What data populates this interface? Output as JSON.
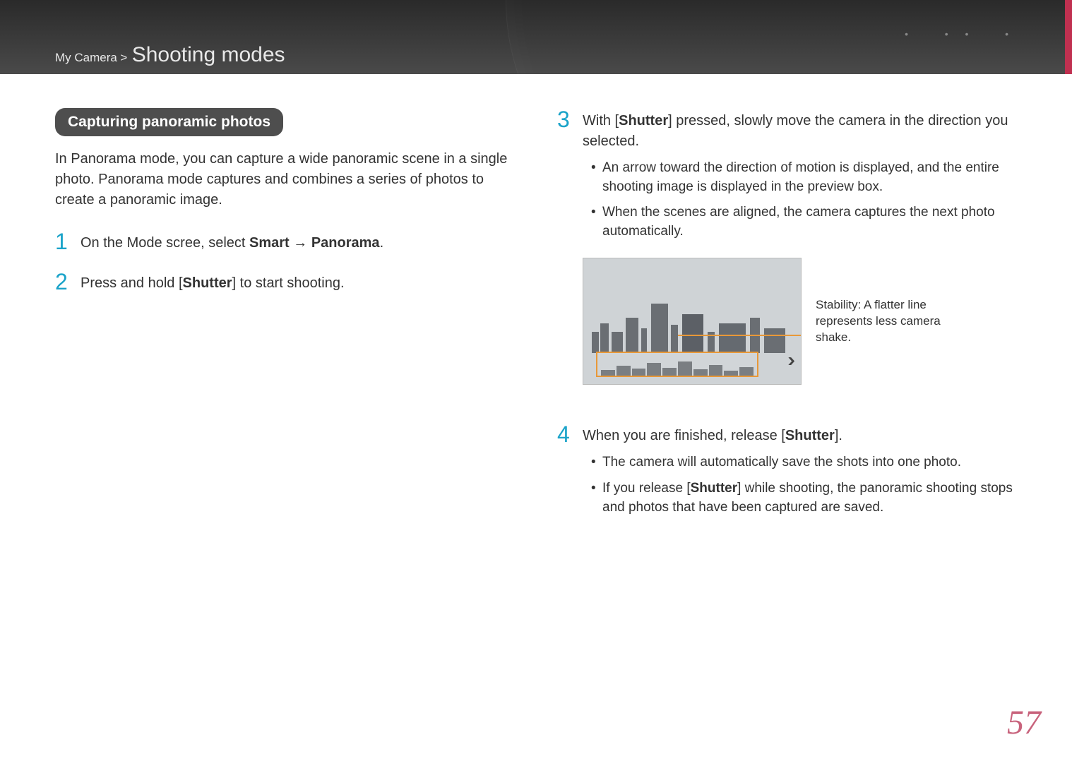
{
  "breadcrumb": {
    "parent": "My Camera",
    "separator": ">",
    "current": "Shooting modes"
  },
  "pill": "Capturing panoramic photos",
  "intro": "In Panorama mode, you can capture a wide panoramic scene in a single photo. Panorama mode captures and combines a series of photos to create a panoramic image.",
  "steps_left": {
    "s1": {
      "num": "1",
      "pre": "On the Mode scree, select ",
      "b1": "Smart",
      "arrow": " → ",
      "b2": "Panorama",
      "post": "."
    },
    "s2": {
      "num": "2",
      "pre": "Press and hold [",
      "b1": "Shutter",
      "post": "] to start shooting."
    }
  },
  "steps_right": {
    "s3": {
      "num": "3",
      "pre": "With [",
      "b1": "Shutter",
      "post": "] pressed, slowly move the camera in the direction you selected.",
      "bullets": [
        "An arrow toward the direction of motion is displayed, and the entire shooting image is displayed in the preview box.",
        "When the scenes are aligned, the camera captures the next photo automatically."
      ]
    },
    "caption": "Stability: A flatter line represents less camera shake.",
    "s4": {
      "num": "4",
      "pre": "When you are finished, release [",
      "b1": "Shutter",
      "post": "].",
      "bullets_html": {
        "b1": "The camera will automatically save the shots into one photo.",
        "b2_pre": "If you release [",
        "b2_bold": "Shutter",
        "b2_post": "] while shooting, the panoramic shooting stops and photos that have been captured are saved."
      }
    }
  },
  "page_number": "57"
}
